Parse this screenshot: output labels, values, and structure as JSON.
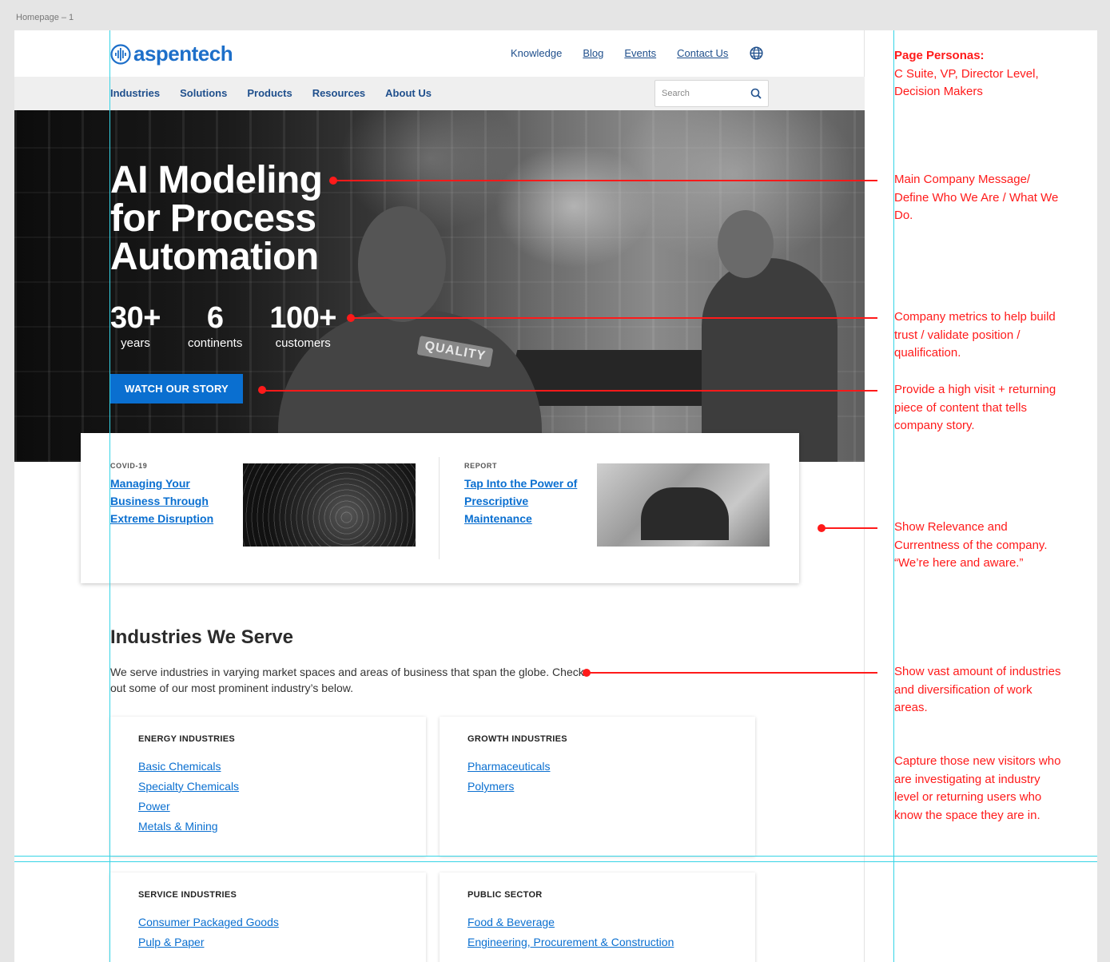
{
  "frame_label": "Homepage – 1",
  "header": {
    "logo_text": "aspentech",
    "util_links": [
      {
        "label": "Knowledge",
        "underline": false
      },
      {
        "label": "Blog",
        "underline": true
      },
      {
        "label": "Events",
        "underline": true
      },
      {
        "label": "Contact Us",
        "underline": true
      }
    ],
    "globe_icon": "globe-icon"
  },
  "nav": {
    "items": [
      "Industries",
      "Solutions",
      "Products",
      "Resources",
      "About Us"
    ],
    "search_placeholder": "Search"
  },
  "hero": {
    "title": "AI Modeling for Process Automation",
    "metrics": [
      {
        "value": "30+",
        "label": "years"
      },
      {
        "value": "6",
        "label": "continents"
      },
      {
        "value": "100+",
        "label": "customers"
      }
    ],
    "cta_label": "WATCH OUR STORY",
    "badge_text": "QUALITY"
  },
  "features": [
    {
      "tag": "COVID-19",
      "link": "Managing Your Business Through Extreme Disruption"
    },
    {
      "tag": "REPORT",
      "link": "Tap Into the Power of Prescriptive Maintenance"
    }
  ],
  "industries": {
    "title": "Industries We Serve",
    "description": "We serve industries in varying market spaces and areas of business that span the globe. Check out some of our most prominent industry’s below.",
    "cards": [
      {
        "title": "ENERGY INDUSTRIES",
        "links": [
          "Basic Chemicals",
          "Specialty Chemicals",
          "Power",
          "Metals & Mining"
        ]
      },
      {
        "title": "GROWTH INDUSTRIES",
        "links": [
          "Pharmaceuticals",
          "Polymers"
        ]
      },
      {
        "title": "SERVICE INDUSTRIES",
        "links": [
          "Consumer Packaged Goods",
          "Pulp & Paper"
        ]
      },
      {
        "title": "PUBLIC SECTOR",
        "links": [
          "Food & Beverage",
          "Engineering, Procurement & Construction"
        ]
      }
    ]
  },
  "annotations": {
    "personas_title": "Page Personas:",
    "personas_text": "C Suite, VP, Director Level, Decision Makers",
    "notes": [
      "Main Company Message/ Define Who We Are / What We Do.",
      "Company metrics to help build trust / validate position / qualification.",
      "Provide a high visit + returning piece of content that tells company story.",
      "Show Relevance and Currentness of the company. “We’re here and aware.”",
      "Show vast amount of industries and diversification of work areas.",
      "Capture those new visitors who are investigating at industry level or returning users who know the space they are in."
    ]
  },
  "colors": {
    "brand_blue": "#1d6fc9",
    "nav_blue": "#1f4f8c",
    "link_blue": "#0a6fd0",
    "annotation_red": "#ff1a1a",
    "guide_cyan": "#36d4e6"
  }
}
